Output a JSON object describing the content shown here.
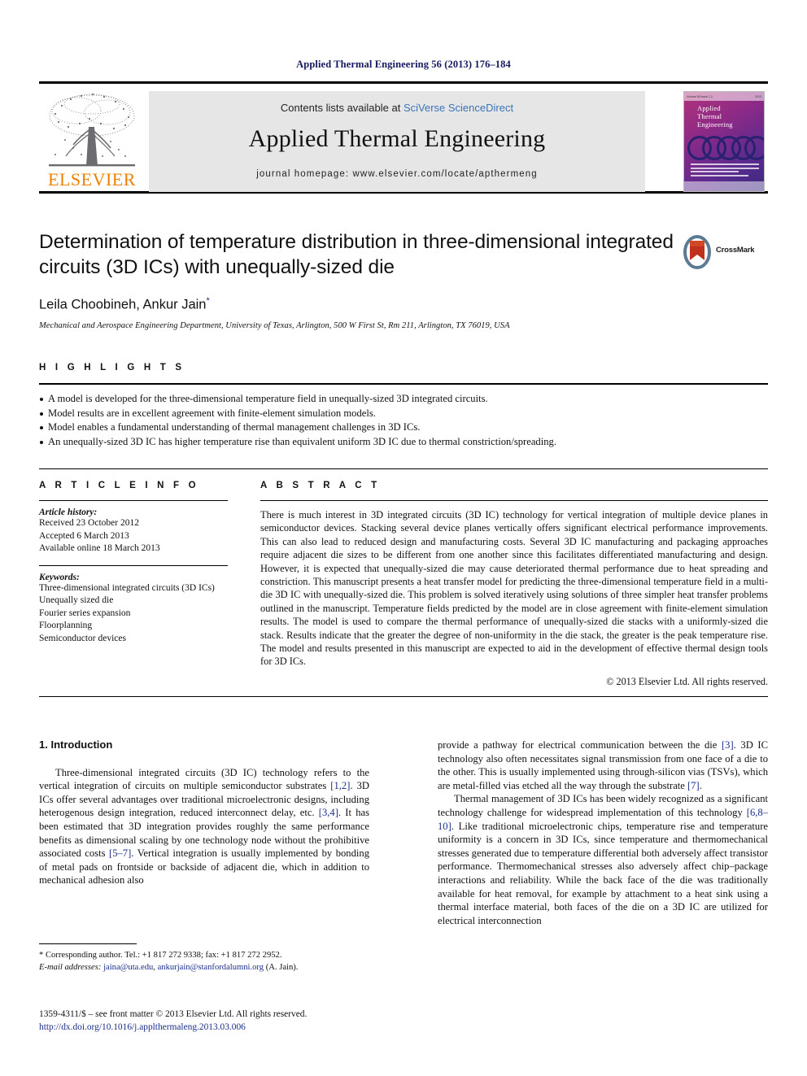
{
  "running_head": "Applied Thermal Engineering 56 (2013) 176–184",
  "masthead": {
    "publisher": "ELSEVIER",
    "contents_prefix": "Contents lists available at ",
    "contents_link": "SciVerse ScienceDirect",
    "journal_title": "Applied Thermal Engineering",
    "homepage": "journal homepage: www.elsevier.com/locate/apthermeng",
    "cover": {
      "line1": "Applied",
      "line2": "Thermal",
      "line3": "Engineering",
      "top_left": "Volume 56  Issue 1-2",
      "top_right": "2013"
    }
  },
  "article": {
    "title": "Determination of temperature distribution in three-dimensional integrated circuits (3D ICs) with unequally-sized die",
    "authors": "Leila Choobineh, Ankur Jain",
    "author_marker": "*",
    "affiliation": "Mechanical and Aerospace Engineering Department, University of Texas, Arlington, 500 W First St, Rm 211, Arlington, TX 76019, USA",
    "crossmark_label": "CrossMark"
  },
  "highlights": {
    "label": "H I G H L I G H T S",
    "items": [
      "A model is developed for the three-dimensional temperature field in unequally-sized 3D integrated circuits.",
      "Model results are in excellent agreement with finite-element simulation models.",
      "Model enables a fundamental understanding of thermal management challenges in 3D ICs.",
      "An unequally-sized 3D IC has higher temperature rise than equivalent uniform 3D IC due to thermal constriction/spreading."
    ]
  },
  "article_info": {
    "label": "A R T I C L E   I N F O",
    "history_head": "Article history:",
    "history": [
      "Received 23 October 2012",
      "Accepted 6 March 2013",
      "Available online 18 March 2013"
    ],
    "keywords_head": "Keywords:",
    "keywords": [
      "Three-dimensional integrated circuits (3D ICs)",
      "Unequally sized die",
      "Fourier series expansion",
      "Floorplanning",
      "Semiconductor devices"
    ]
  },
  "abstract": {
    "label": "A B S T R A C T",
    "text": "There is much interest in 3D integrated circuits (3D IC) technology for vertical integration of multiple device planes in semiconductor devices. Stacking several device planes vertically offers significant electrical performance improvements. This can also lead to reduced design and manufacturing costs. Several 3D IC manufacturing and packaging approaches require adjacent die sizes to be different from one another since this facilitates differentiated manufacturing and design. However, it is expected that unequally-sized die may cause deteriorated thermal performance due to heat spreading and constriction. This manuscript presents a heat transfer model for predicting the three-dimensional temperature field in a multi-die 3D IC with unequally-sized die. This problem is solved iteratively using solutions of three simpler heat transfer problems outlined in the manuscript. Temperature fields predicted by the model are in close agreement with finite-element simulation results. The model is used to compare the thermal performance of unequally-sized die stacks with a uniformly-sized die stack. Results indicate that the greater the degree of non-uniformity in the die stack, the greater is the peak temperature rise. The model and results presented in this manuscript are expected to aid in the development of effective thermal design tools for 3D ICs.",
    "copyright": "© 2013 Elsevier Ltd. All rights reserved."
  },
  "body": {
    "section_heading": "1. Introduction",
    "left_paragraph_1": {
      "part1": "Three-dimensional integrated circuits (3D IC) technology refers to the vertical integration of circuits on multiple semiconductor substrates ",
      "cite1": "[1,2]",
      "part2": ". 3D ICs offer several advantages over traditional microelectronic designs, including heterogenous design integration, reduced interconnect delay, etc. ",
      "cite2": "[3,4]",
      "part3": ". It has been estimated that 3D integration provides roughly the same performance benefits as dimensional scaling by one technology node without the prohibitive associated costs ",
      "cite3": "[5–7]",
      "part4": ". Vertical integration is usually implemented by bonding of metal pads on frontside or backside of adjacent die, which in addition to mechanical adhesion also"
    },
    "right_paragraph_1": {
      "part1": "provide a pathway for electrical communication between the die ",
      "cite1": "[3]",
      "part2": ". 3D IC technology also often necessitates signal transmission from one face of a die to the other. This is usually implemented using through-silicon vias (TSVs), which are metal-filled vias etched all the way through the substrate ",
      "cite2": "[7]",
      "part3": "."
    },
    "right_paragraph_2": {
      "part1": "Thermal management of 3D ICs has been widely recognized as a significant technology challenge for widespread implementation of this technology ",
      "cite1": "[6,8–10]",
      "part2": ". Like traditional microelectronic chips, temperature rise and temperature uniformity is a concern in 3D ICs, since temperature and thermomechanical stresses generated due to temperature differential both adversely affect transistor performance. Thermomechanical stresses also adversely affect chip–package interactions and reliability. While the back face of the die was traditionally available for heat removal, for example by attachment to a heat sink using a thermal interface material, both faces of the die on a 3D IC are utilized for electrical interconnection"
    }
  },
  "footnote": {
    "corresponding": "* Corresponding author. Tel.: +1 817 272 9338; fax: +1 817 272 2952.",
    "email_label": "E-mail addresses:",
    "email1": "jaina@uta.edu",
    "email_sep": ", ",
    "email2": "ankurjain@stanfordalumni.org",
    "email_suffix": " (A. Jain)."
  },
  "page_footer": {
    "issn_line": "1359-4311/$ – see front matter © 2013 Elsevier Ltd. All rights reserved.",
    "doi": "http://dx.doi.org/10.1016/j.applthermaleng.2013.03.006"
  },
  "colors": {
    "link_blue": "#1b2f8a",
    "sd_blue": "#3a74b8",
    "elsevier_orange": "#f08000",
    "header_navy": "#151b5e"
  }
}
